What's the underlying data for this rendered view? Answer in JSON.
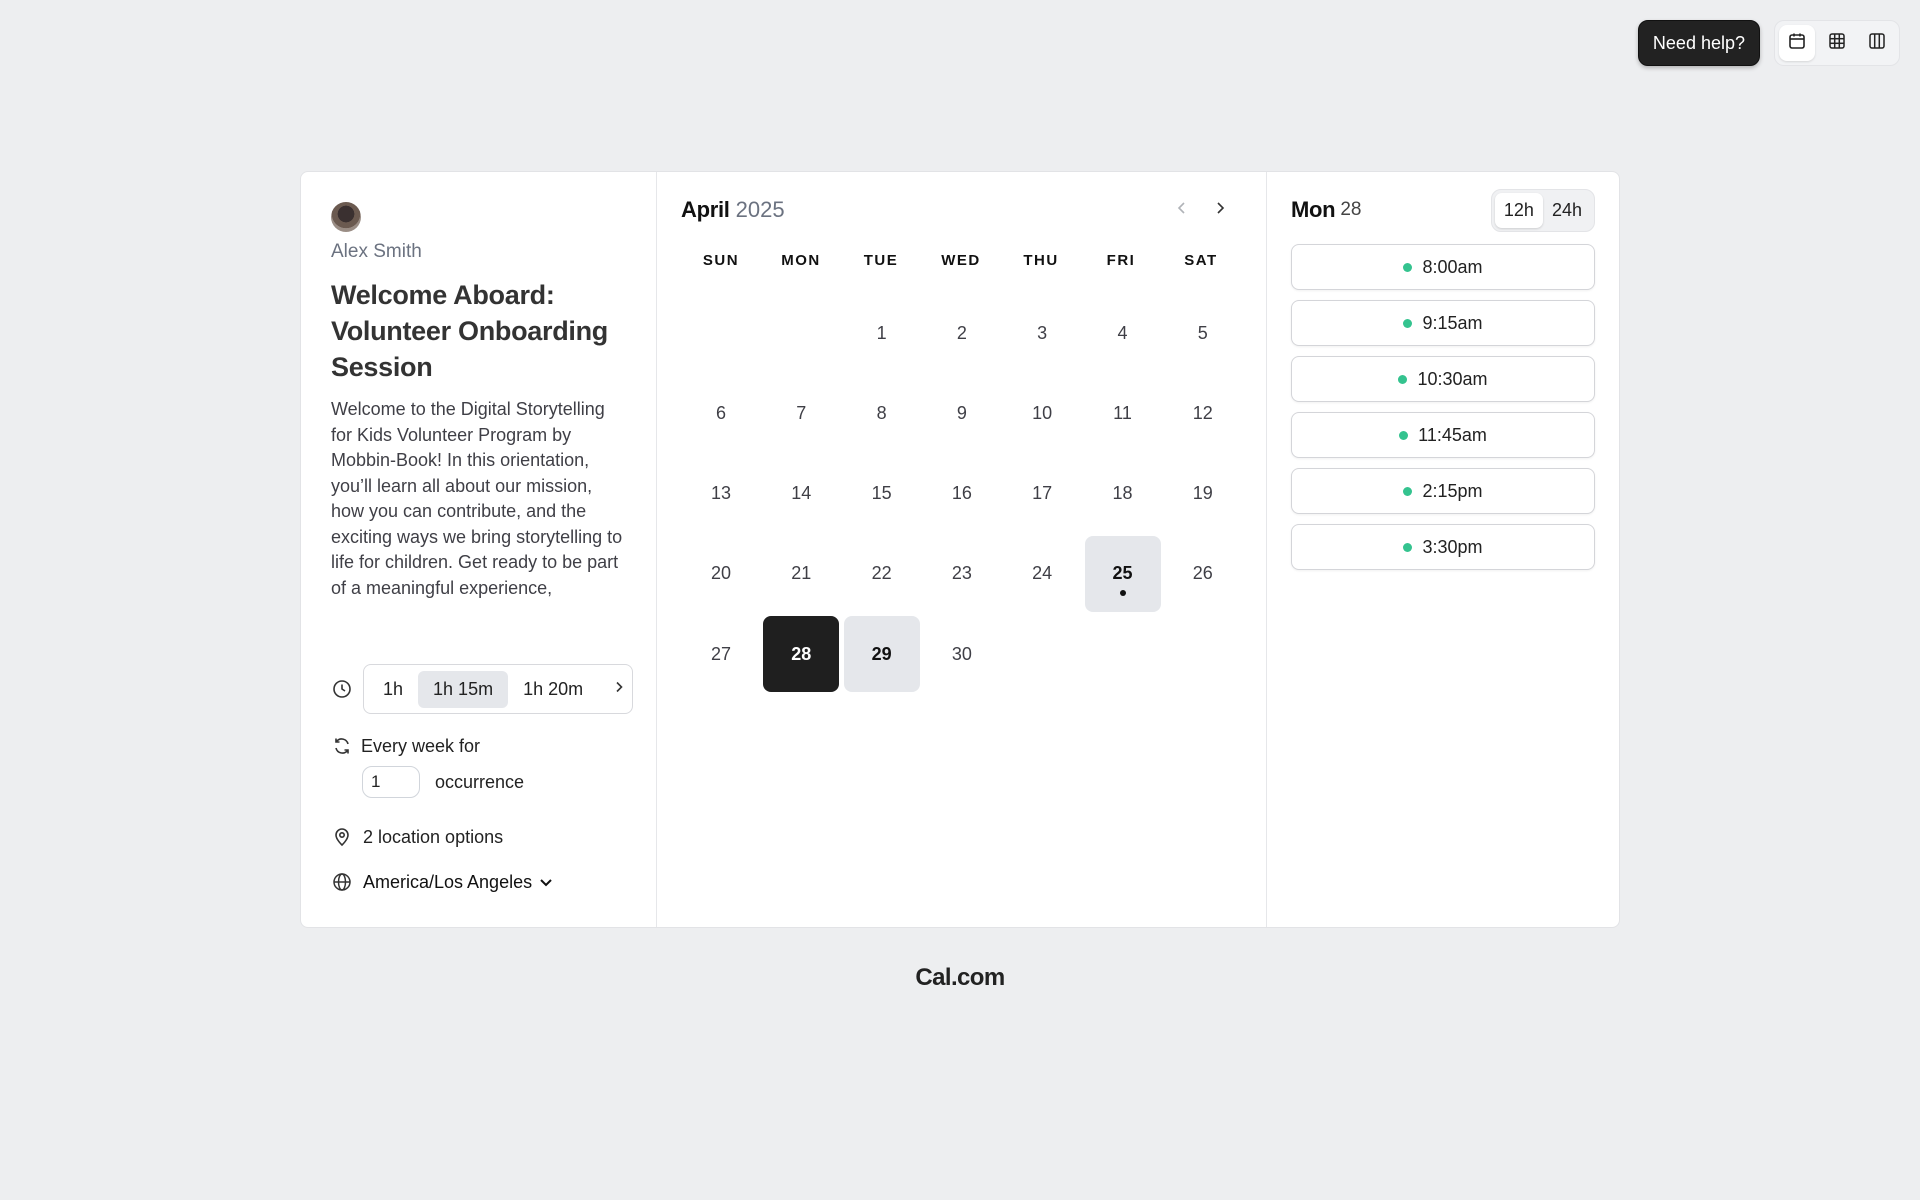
{
  "header": {
    "help_label": "Need help?",
    "view_icons": [
      "calendar-icon",
      "grid-icon",
      "columns-icon"
    ]
  },
  "event": {
    "host": "Alex Smith",
    "title": "Welcome Aboard: Volunteer Onboarding Session",
    "description": "Welcome to the Digital Storytelling for Kids Volunteer Program by Mobbin-Book! In this orientation, you’ll learn all about our mission, how you can contribute, and the exciting ways we bring storytelling to life for children. Get ready to be part of a meaningful experience,",
    "durations": [
      "1h",
      "1h 15m",
      "1h 20m"
    ],
    "selected_duration": "1h 15m",
    "recurrence_label": "Every week for",
    "occurrence_value": "1",
    "occurrence_label": "occurrence",
    "location_label": "2 location options",
    "timezone": "America/Los Angeles"
  },
  "calendar": {
    "month": "April",
    "year": "2025",
    "weekdays": [
      "SUN",
      "MON",
      "TUE",
      "WED",
      "THU",
      "FRI",
      "SAT"
    ],
    "first_weekday_index": 2,
    "days_in_month": 30,
    "available_days": [
      25,
      29
    ],
    "selected_day": 28,
    "today_dot_day": 25
  },
  "slots": {
    "day_name": "Mon",
    "day_number": "28",
    "format_options": [
      "12h",
      "24h"
    ],
    "selected_format": "12h",
    "times": [
      "8:00am",
      "9:15am",
      "10:30am",
      "11:45am",
      "2:15pm",
      "3:30pm"
    ],
    "available_color": "#34c38f"
  },
  "footer": {
    "brand": "Cal.com"
  }
}
